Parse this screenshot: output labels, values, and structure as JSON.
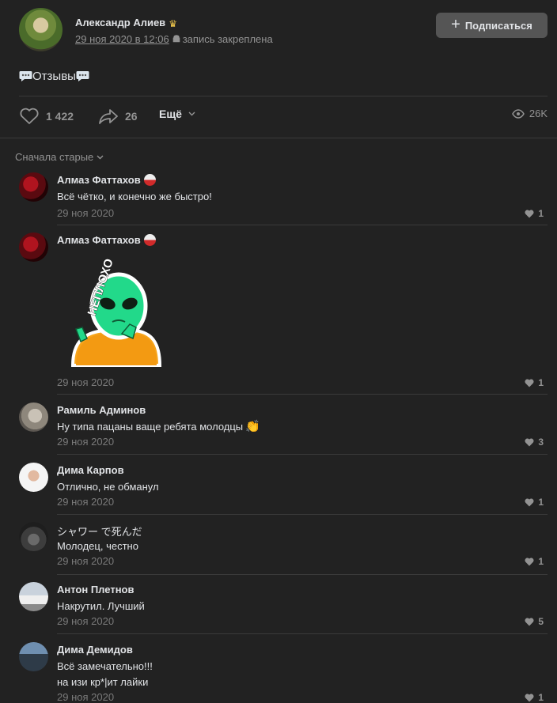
{
  "post": {
    "author": "Александр Алиев",
    "date": "29 ноя 2020 в 12:06",
    "pinned": "запись закреплена",
    "subscribe": "Подписаться",
    "text": "Отзывы",
    "likes": "1 422",
    "shares": "26",
    "more": "Ещё",
    "views": "26K"
  },
  "sort_label": "Сначала старые",
  "sticker_text": "НЕПЛОХО",
  "comments": [
    {
      "name": "Алмаз Фаттахов",
      "text": "Всё чётко, и конечно же быстро!",
      "date": "29 ноя 2020",
      "likes": "1"
    },
    {
      "name": "Алмаз Фаттахов",
      "date": "29 ноя 2020",
      "likes": "1"
    },
    {
      "name": "Рамиль Админов",
      "text": "Ну типа пацаны ваще ребята молодцы",
      "date": "29 ноя 2020",
      "likes": "3"
    },
    {
      "name": "Дима Карпов",
      "text": "Отлично, не обманул",
      "date": "29 ноя 2020",
      "likes": "1"
    },
    {
      "name": "シャワー で死んだ",
      "text": "Молодец, честно",
      "date": "29 ноя 2020",
      "likes": "1"
    },
    {
      "name": "Антон Плетнов",
      "text": "Накрутил. Лучший",
      "date": "29 ноя 2020",
      "likes": "5"
    },
    {
      "name": "Дима Демидов",
      "text": "Всё замечательно!!!",
      "text2": "на изи кр*|ит лайки",
      "date": "29 ноя 2020",
      "likes": "1"
    }
  ],
  "colors": {
    "background": "#222222",
    "text": "#e1e3e6",
    "muted": "#939393",
    "button": "#555555"
  }
}
